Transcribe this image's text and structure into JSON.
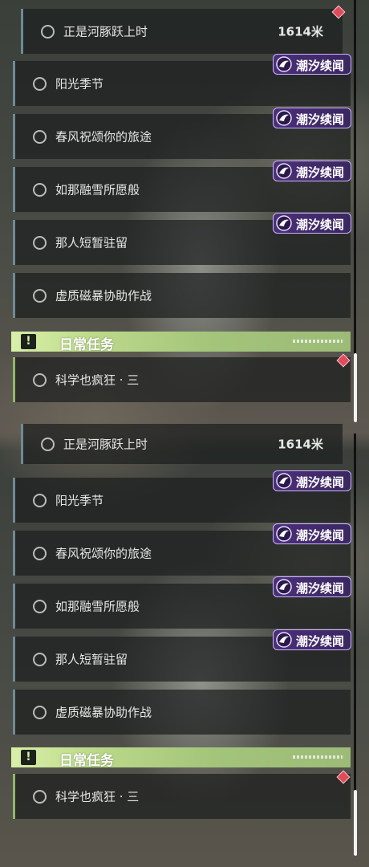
{
  "quest_list": {
    "tracked_quest": {
      "title": "正是河豚跃上时",
      "distance": "1614米"
    },
    "quests": [
      {
        "title": "阳光季节"
      },
      {
        "title": "春风祝颂你的旅途"
      },
      {
        "title": "如那融雪所愿般"
      },
      {
        "title": "那人短暂驻留"
      },
      {
        "title": "虚质磁暴协助作战"
      }
    ],
    "tag_label": "潮汐续闻",
    "daily_section": {
      "header": "日常任务",
      "header_icon": "!"
    },
    "daily_quests": [
      {
        "title": "科学也疯狂 · 三"
      }
    ]
  },
  "colors": {
    "tag_bg": "#4b2f78",
    "tag_border": "#c9b5ff",
    "daily_header": "#bcd98a",
    "quest_border": "#6f8a96",
    "daily_border": "#8fb86a",
    "marker": "#e04a5a"
  },
  "icons": {
    "tag": "tide-swirl-icon",
    "marker": "diamond-marker-icon",
    "daily": "exclamation-icon",
    "status": "circle-status-icon"
  }
}
